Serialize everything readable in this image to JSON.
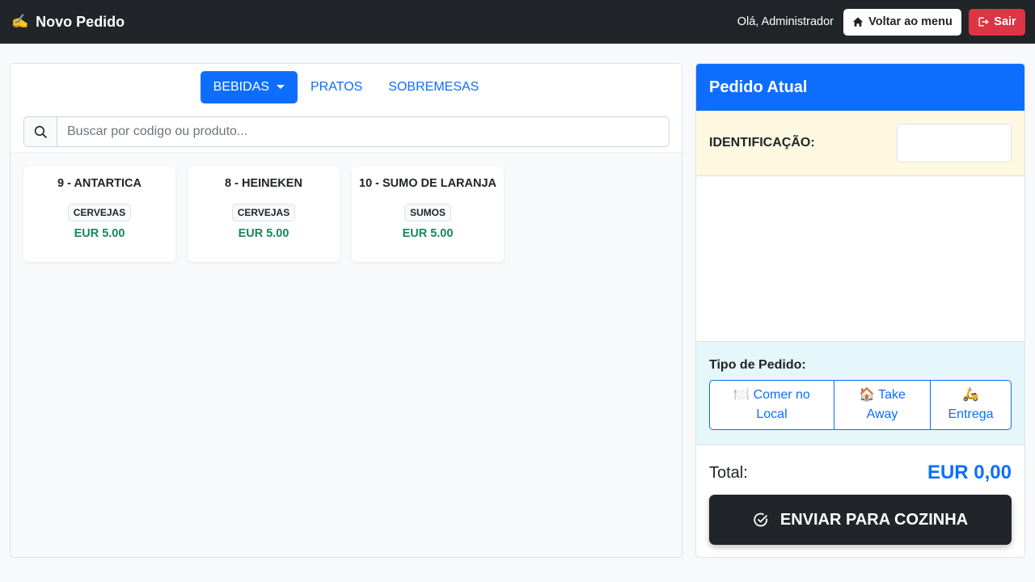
{
  "navbar": {
    "brand_icon": "✍️",
    "title": "Novo Pedido",
    "greeting": "Olá, Administrador",
    "menu_button": "Voltar ao menu",
    "exit_button": "Sair"
  },
  "tabs": [
    {
      "label": "BEBIDAS",
      "active": true
    },
    {
      "label": "PRATOS",
      "active": false
    },
    {
      "label": "SOBREMESAS",
      "active": false
    }
  ],
  "search": {
    "placeholder": "Buscar por codigo ou produto...",
    "value": ""
  },
  "products": [
    {
      "title": "9 - ANTARTICA",
      "category": "CERVEJAS",
      "price": "EUR 5.00"
    },
    {
      "title": "8 - HEINEKEN",
      "category": "CERVEJAS",
      "price": "EUR 5.00"
    },
    {
      "title": "10 - SUMO DE LARANJA",
      "category": "SUMOS",
      "price": "EUR 5.00"
    }
  ],
  "order": {
    "title": "Pedido Atual",
    "identification_label": "IDENTIFICAÇÃO:",
    "identification_value": "",
    "order_type_label": "Tipo de Pedido:",
    "order_types": [
      {
        "icon": "🍽️",
        "line1": "Comer no",
        "line2": "Local"
      },
      {
        "icon": "🏠",
        "line1": "Take",
        "line2": "Away"
      },
      {
        "icon": "🛵",
        "line1": "",
        "line2": "Entrega"
      }
    ],
    "total_label": "Total:",
    "total_value": "EUR 0,00",
    "send_button": "ENVIAR PARA COZINHA"
  },
  "colors": {
    "primary": "#0d6efd",
    "dark": "#212529",
    "danger": "#dc3545",
    "success": "#198754",
    "ident_bg": "#fff8e1",
    "tipo_bg": "#e5f7fa"
  }
}
